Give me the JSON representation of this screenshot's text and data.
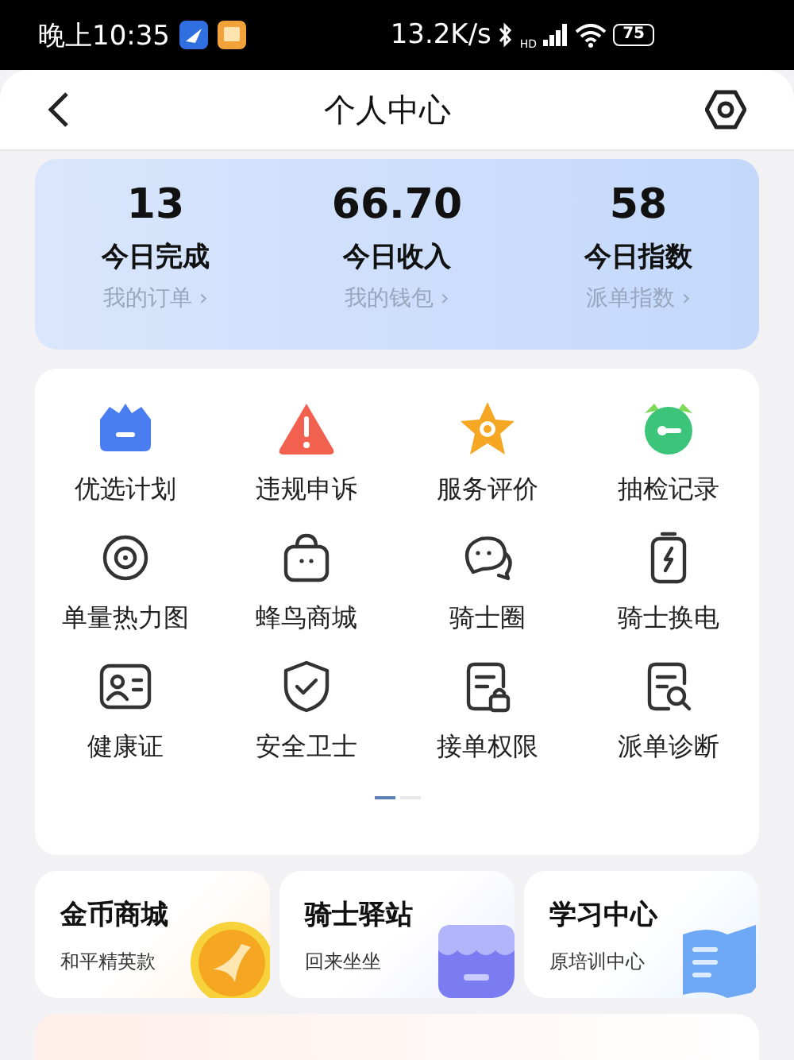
{
  "status_bar": {
    "time": "晚上10:35",
    "speed": "13.2K/s",
    "network": "HD",
    "battery": "75"
  },
  "header": {
    "title": "个人中心"
  },
  "stats": [
    {
      "value": "13",
      "label": "今日完成",
      "link": "我的订单",
      "arrow": "›"
    },
    {
      "value": "66.70",
      "label": "今日收入",
      "link": "我的钱包",
      "arrow": "›"
    },
    {
      "value": "58",
      "label": "今日指数",
      "link": "派单指数",
      "arrow": "›"
    }
  ],
  "menu": [
    {
      "label": "优选计划"
    },
    {
      "label": "违规申诉"
    },
    {
      "label": "服务评价"
    },
    {
      "label": "抽检记录"
    },
    {
      "label": "单量热力图"
    },
    {
      "label": "蜂鸟商城"
    },
    {
      "label": "骑士圈"
    },
    {
      "label": "骑士换电"
    },
    {
      "label": "健康证"
    },
    {
      "label": "安全卫士"
    },
    {
      "label": "接单权限"
    },
    {
      "label": "派单诊断"
    }
  ],
  "pager": [
    {
      "selected": true
    },
    {
      "selected": false
    }
  ],
  "tiles": [
    {
      "title": "金币商城",
      "subtitle": "和平精英款"
    },
    {
      "title": "骑士驿站",
      "subtitle": "回来坐坐"
    },
    {
      "title": "学习中心",
      "subtitle": "原培训中心"
    }
  ]
}
